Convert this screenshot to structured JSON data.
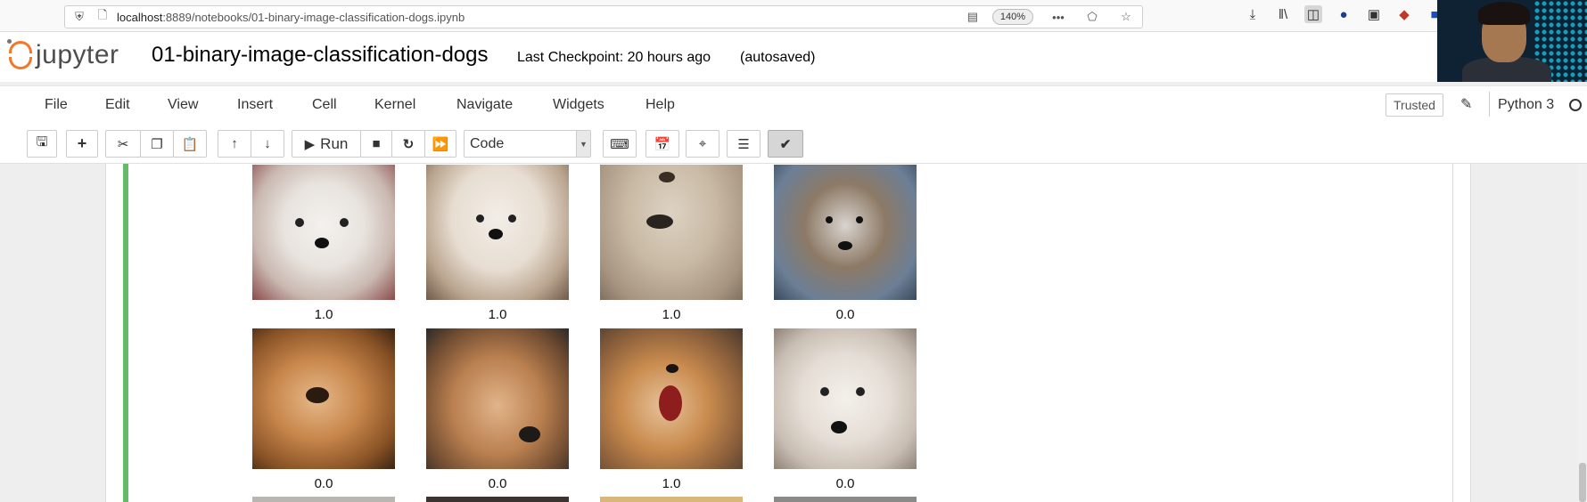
{
  "browser": {
    "url_host": "localhost",
    "url_path": ":8889/notebooks/01-binary-image-classification-dogs.ipynb",
    "zoom": "140%"
  },
  "header": {
    "logo_text": "jupyter",
    "notebook_title": "01-binary-image-classification-dogs",
    "checkpoint": "Last Checkpoint: 20 hours ago",
    "autosave_status": "(autosaved)"
  },
  "menu": {
    "items": [
      "File",
      "Edit",
      "View",
      "Insert",
      "Cell",
      "Kernel",
      "Navigate",
      "Widgets",
      "Help"
    ],
    "trusted": "Trusted",
    "kernel": "Python 3"
  },
  "toolbar": {
    "run_label": "Run",
    "cell_type": "Code",
    "icons": [
      "save-icon",
      "plus-icon",
      "scissors-icon",
      "copy-icon",
      "paste-icon",
      "arrow-up-icon",
      "arrow-down-icon",
      "play-icon",
      "stop-icon",
      "restart-icon",
      "fast-forward-icon",
      "keyboard-icon",
      "calendar-icon",
      "crosshair-icon",
      "list-icon",
      "checkmark-icon"
    ]
  },
  "output": {
    "row1_labels": [
      "1.0",
      "1.0",
      "1.0",
      "0.0"
    ],
    "row2_labels": [
      "0.0",
      "0.0",
      "1.0",
      "0.0"
    ],
    "colors": {
      "cell_border": "#66bb6a",
      "jupyter_orange": "#f37726"
    }
  }
}
